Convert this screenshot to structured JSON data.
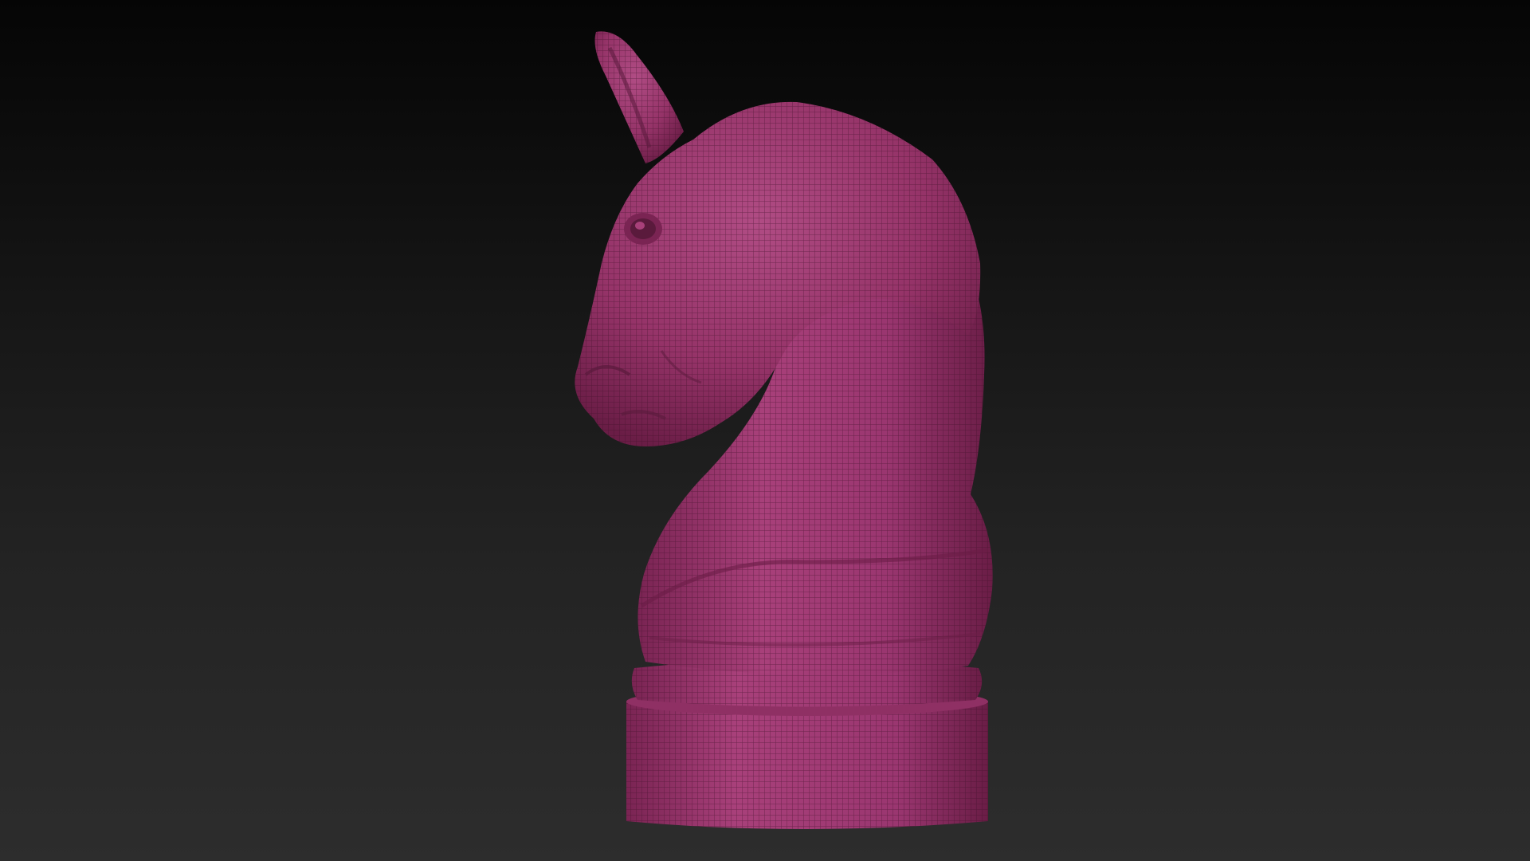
{
  "viewport": {
    "background_top": "#050505",
    "background_bottom": "#2d2d2d"
  },
  "model": {
    "subject": "chess-knight",
    "material_color": "#a23a72",
    "highlight_color": "#c9609a",
    "shadow_color": "#5a1a3c",
    "wire_color": "#3d0f27",
    "display_mode": "wireframe-shaded"
  }
}
